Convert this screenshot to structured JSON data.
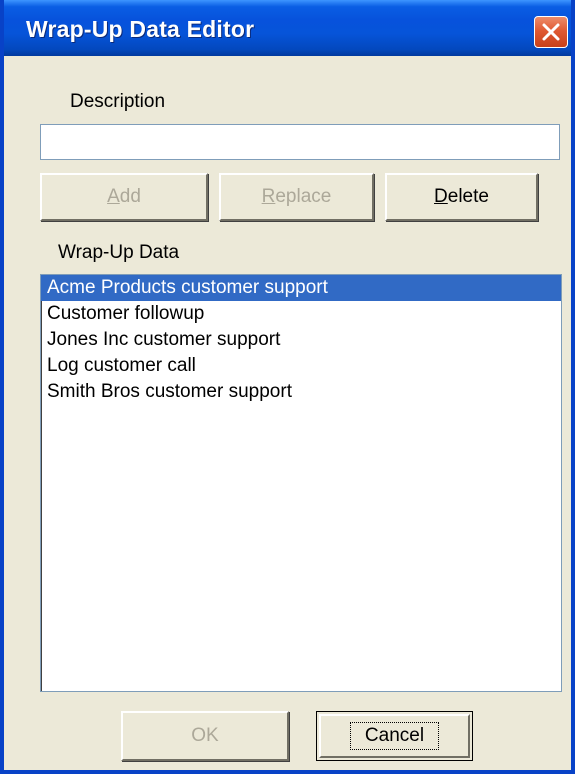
{
  "window": {
    "title": "Wrap-Up Data Editor"
  },
  "description": {
    "label": "Description",
    "value": "",
    "placeholder": ""
  },
  "buttons": {
    "add": {
      "label_u": "A",
      "label_rest": "dd",
      "enabled": false
    },
    "replace": {
      "label_u": "R",
      "label_rest": "eplace",
      "enabled": false
    },
    "delete": {
      "label_u": "D",
      "label_rest": "elete",
      "enabled": true
    },
    "ok": {
      "label": "OK",
      "enabled": false
    },
    "cancel": {
      "label": "Cancel",
      "enabled": true
    }
  },
  "wrapup": {
    "label": "Wrap-Up Data",
    "items": [
      {
        "label": "Acme Products customer support",
        "selected": true
      },
      {
        "label": "Customer followup",
        "selected": false
      },
      {
        "label": "Jones Inc customer support",
        "selected": false
      },
      {
        "label": "Log customer call",
        "selected": false
      },
      {
        "label": "Smith Bros customer support",
        "selected": false
      }
    ]
  },
  "colors": {
    "titlebar": "#0A5EE4",
    "selection": "#316AC5",
    "dialog_bg": "#ECE9D8",
    "close_button": "#E05A33"
  },
  "icons": {
    "close": "close-icon"
  }
}
